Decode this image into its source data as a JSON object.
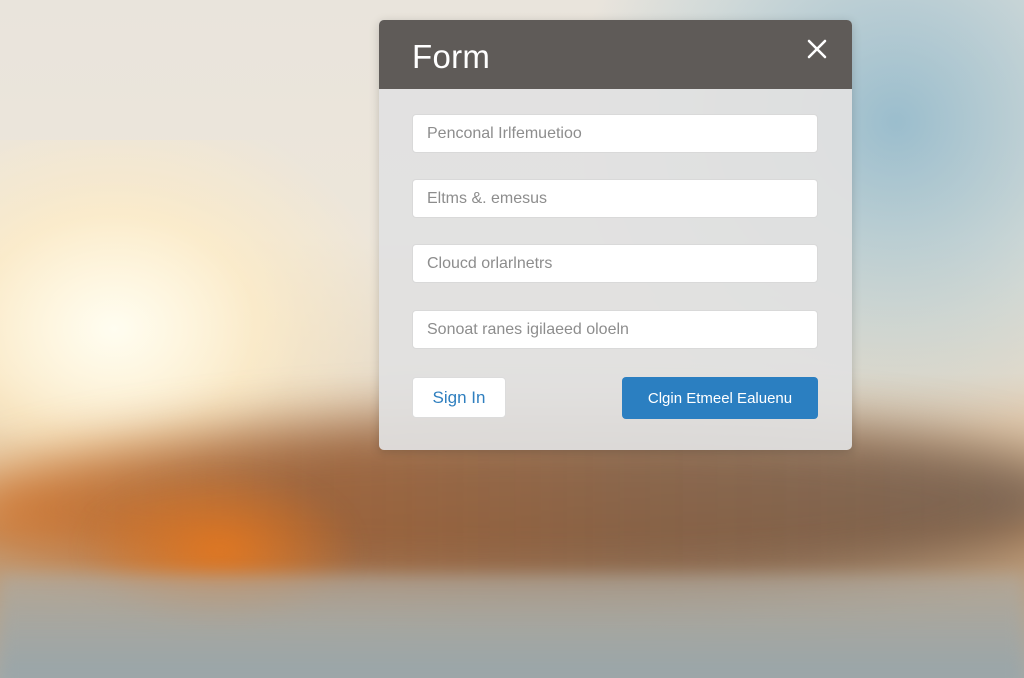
{
  "dialog": {
    "title": "Form",
    "close_icon": "close-icon",
    "fields": [
      {
        "placeholder": "Penconal Irlfemuetioo",
        "value": ""
      },
      {
        "placeholder": "Eltms &. emesus",
        "value": ""
      },
      {
        "placeholder": "Cloucd orlarlnetrs",
        "value": ""
      },
      {
        "placeholder": "Sonoat ranes igilaeed oloeln",
        "value": ""
      }
    ],
    "secondary_button_label": "Sign In",
    "primary_button_label": "Clgin Etmeel Ealuenu"
  },
  "colors": {
    "header": "#5f5b58",
    "primary_button": "#2b7fc1",
    "secondary_button_text": "#2f7fbf"
  }
}
